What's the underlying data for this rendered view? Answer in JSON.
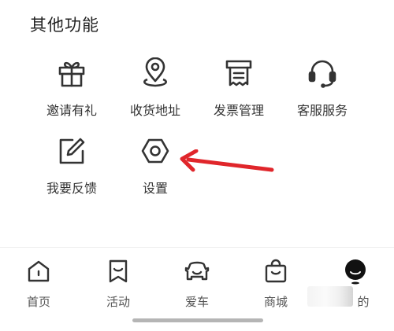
{
  "section": {
    "title": "其他功能"
  },
  "features": [
    {
      "label": "邀请有礼",
      "icon": "gift-icon"
    },
    {
      "label": "收货地址",
      "icon": "location-pin-icon"
    },
    {
      "label": "发票管理",
      "icon": "invoice-icon"
    },
    {
      "label": "客服服务",
      "icon": "headset-icon"
    },
    {
      "label": "我要反馈",
      "icon": "feedback-edit-icon"
    },
    {
      "label": "设置",
      "icon": "settings-hexagon-icon"
    }
  ],
  "tabbar": {
    "items": [
      {
        "label": "首页",
        "icon": "home-icon"
      },
      {
        "label": "活动",
        "icon": "bookmark-flag-icon"
      },
      {
        "label": "爱车",
        "icon": "car-icon"
      },
      {
        "label": "商城",
        "icon": "shopping-bag-icon"
      },
      {
        "label": "的",
        "icon": "avatar-icon"
      }
    ]
  },
  "annotation": {
    "color": "#e0262b",
    "target": "设置"
  },
  "colors": {
    "icon_stroke": "#333333",
    "text": "#333333",
    "avatar": "#111111"
  }
}
